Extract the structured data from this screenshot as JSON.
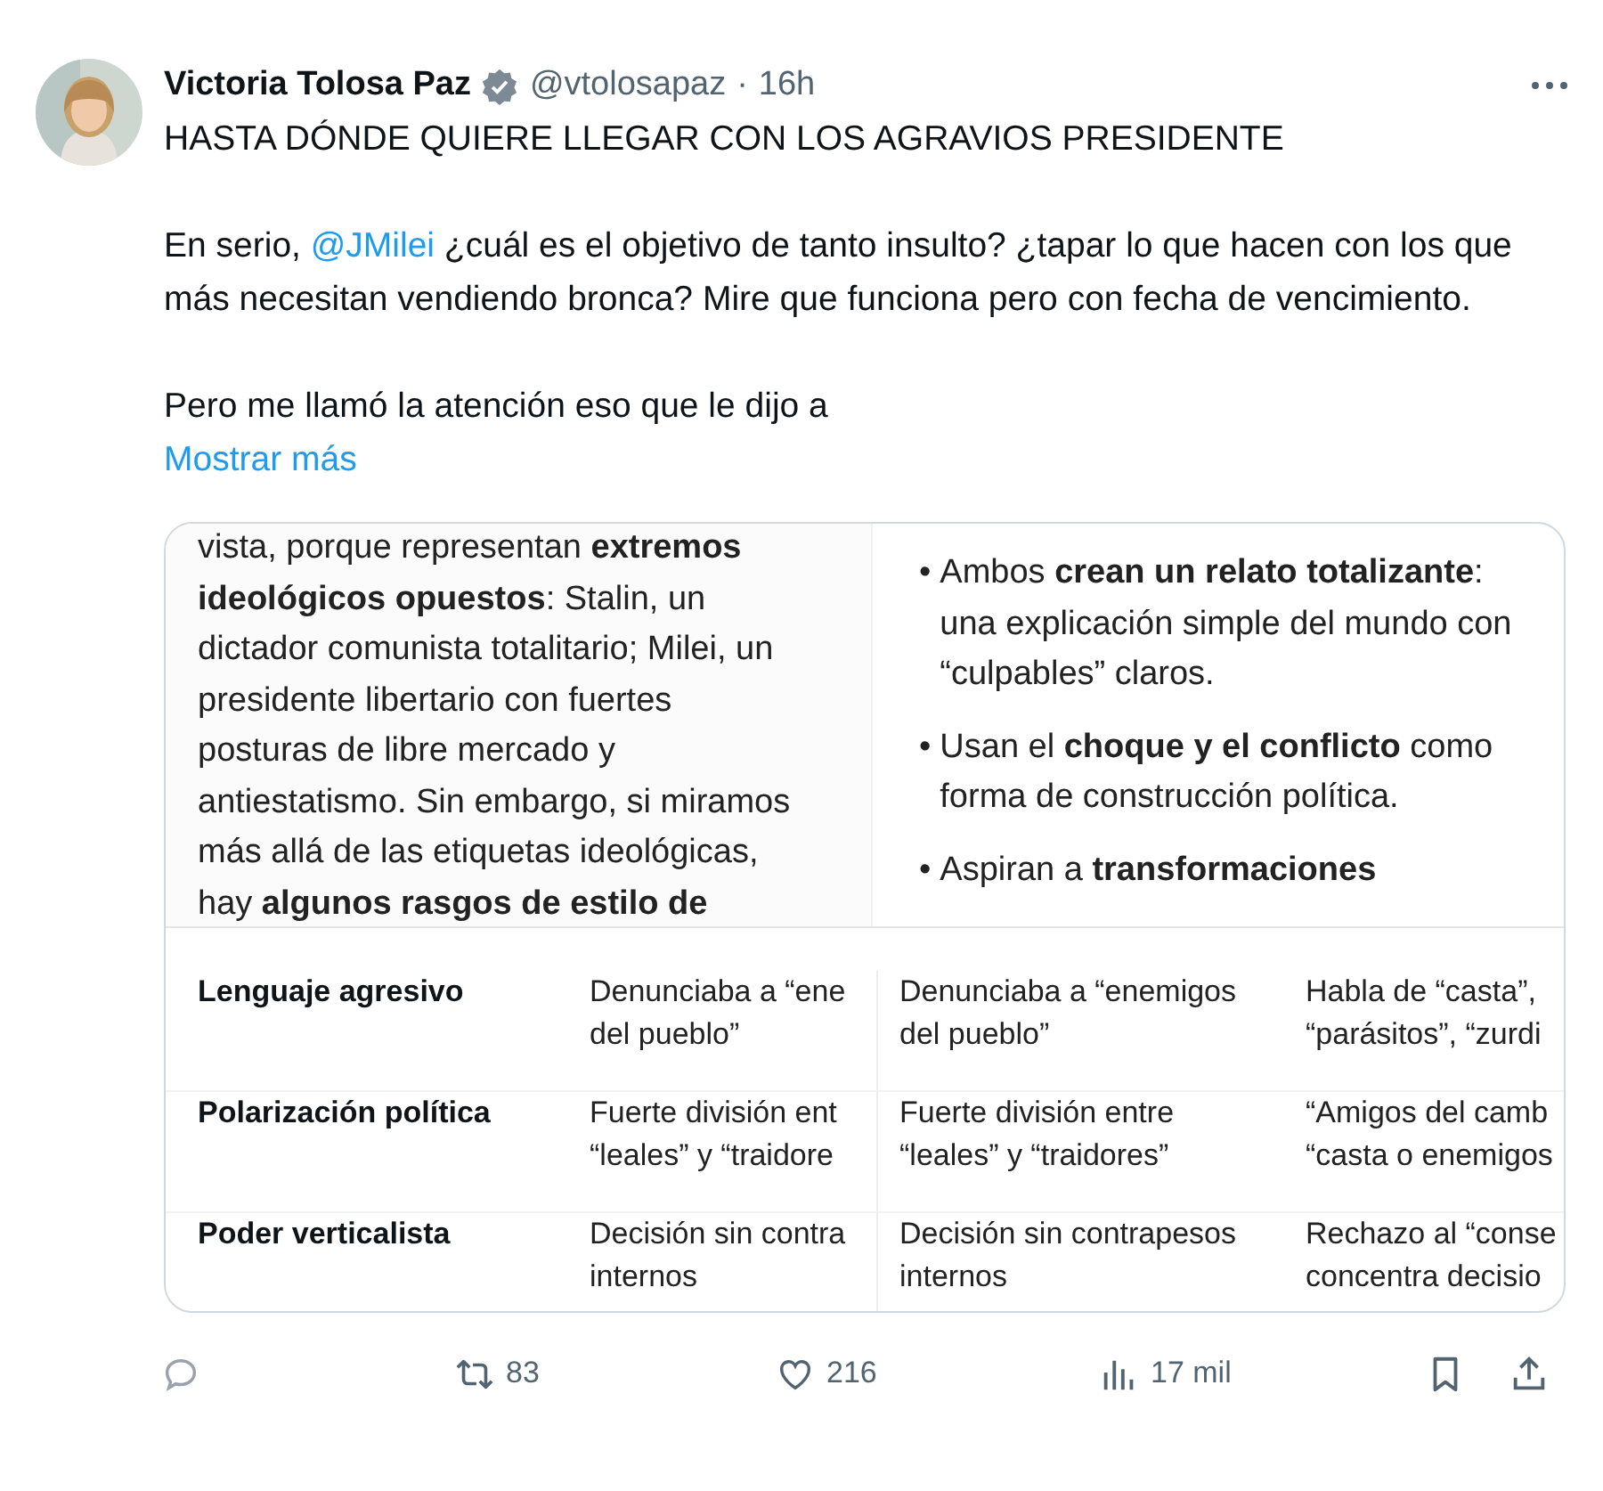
{
  "tweet": {
    "author": {
      "name": "Victoria Tolosa Paz",
      "verified": true,
      "handle": "@vtolosapaz",
      "separator": "·",
      "time": "16h"
    },
    "paragraphs": [
      [
        {
          "kind": "text",
          "text": "HASTA DÓNDE QUIERE LLEGAR CON LOS AGRAVIOS PRESIDENTE"
        }
      ],
      [
        {
          "kind": "text",
          "text": "En serio, "
        },
        {
          "kind": "mention",
          "text": "@JMilei"
        },
        {
          "kind": "text",
          "text": " ¿cuál es el objetivo de tanto insulto? ¿tapar lo que hacen con los que más necesitan vendiendo bronca? Mire que funciona pero con fecha de vencimiento."
        }
      ],
      [
        {
          "kind": "text",
          "text": "Pero me llamó la atención eso que le dijo a"
        }
      ]
    ],
    "show_more": "Mostrar más",
    "media": {
      "left_lines": [
        "vista, porque representan **extremos**",
        "**ideológicos opuestos**: Stalin, un",
        "dictador comunista totalitario; Milei, un",
        "presidente libertario con fuertes",
        "posturas de libre mercado y",
        "antiestatismo. Sin embargo, si miramos",
        "más allá de las etiquetas ideológicas,",
        "hay **algunos rasgos de estilo de**"
      ],
      "bullets": [
        {
          "mark": "•",
          "lines": [
            "Ambos **crean un relato totalizante**:",
            "una explicación simple del mundo con",
            "“culpables” claros."
          ]
        },
        {
          "mark": "•",
          "lines": [
            "Usan el **choque y el conflicto** como",
            "forma de construcción política."
          ]
        },
        {
          "mark": "•",
          "lines": [
            "Aspiran a **transformaciones**"
          ]
        }
      ],
      "rows": [
        {
          "label": "Lenguaje agresivo",
          "cells": [
            [
              "Denunciaba a “ene",
              "del pueblo”"
            ],
            [
              "Denunciaba a “enemigos",
              "del pueblo”"
            ],
            [
              "Habla de “casta”,",
              "“parásitos”, “zurdi"
            ]
          ]
        },
        {
          "label": "Polarización política",
          "cells": [
            [
              "Fuerte división ent",
              "“leales” y “traidore"
            ],
            [
              "Fuerte división entre",
              "“leales” y “traidores”"
            ],
            [
              "“Amigos del camb",
              "“casta o enemigos"
            ]
          ]
        },
        {
          "label": "Poder verticalista",
          "cells": [
            [
              "Decisión sin contra",
              "internos"
            ],
            [
              "Decisión sin contrapesos",
              "internos"
            ],
            [
              "Rechazo al “conse",
              "concentra decisio"
            ]
          ]
        }
      ]
    },
    "actions": [
      {
        "kind": "reply"
      },
      {
        "kind": "retweet",
        "count": "83"
      },
      {
        "kind": "like",
        "count": "216"
      },
      {
        "kind": "views",
        "count": "17 mil"
      },
      {
        "kind": "bookmark"
      },
      {
        "kind": "share"
      }
    ]
  }
}
